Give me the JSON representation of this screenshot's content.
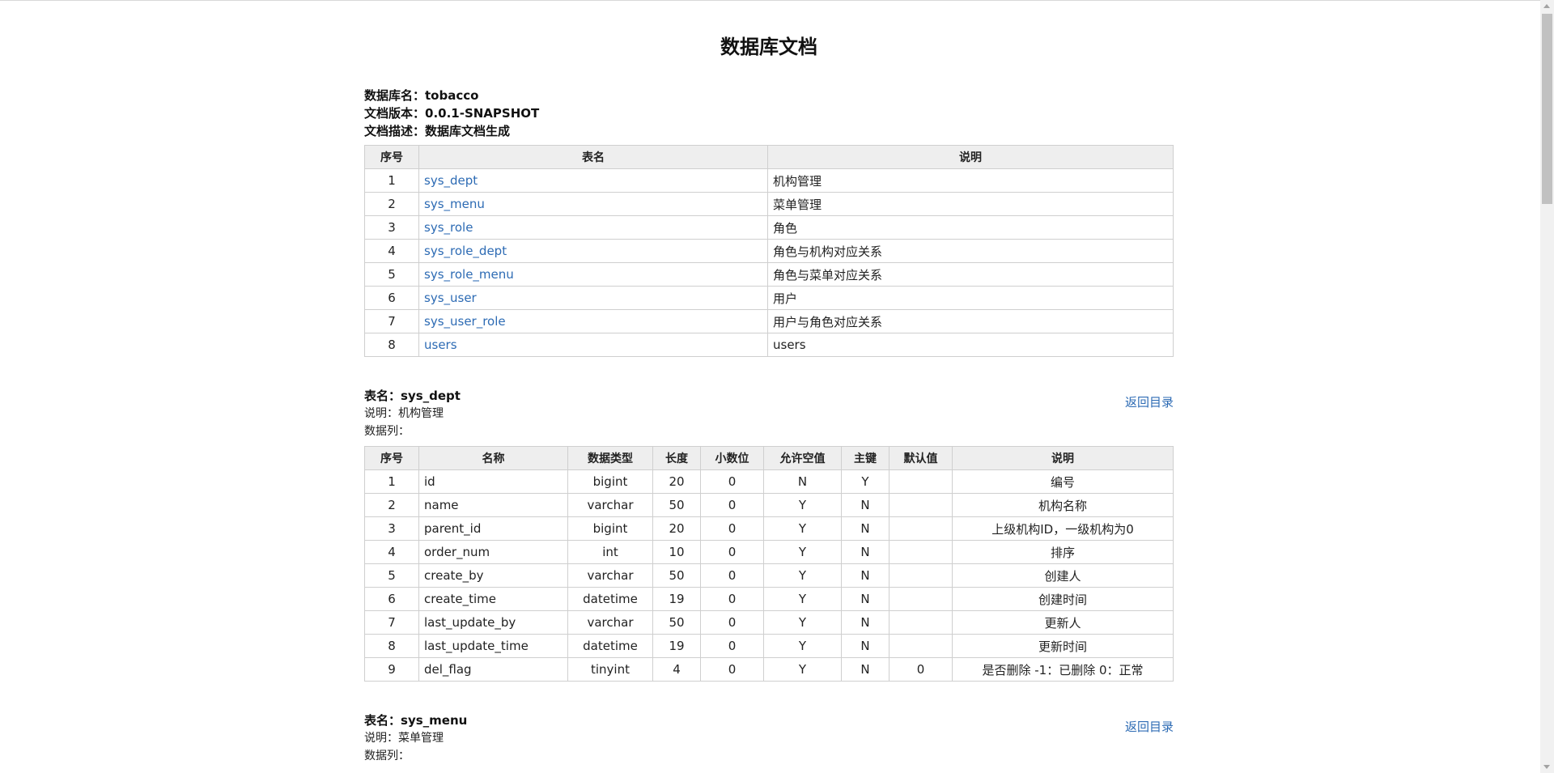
{
  "doc": {
    "title": "数据库文档",
    "db_label": "数据库名：",
    "db_name": "tobacco",
    "version_label": "文档版本：",
    "version": "0.0.1-SNAPSHOT",
    "desc_label": "文档描述：",
    "desc": "数据库文档生成"
  },
  "toc": {
    "headers": [
      "序号",
      "表名",
      "说明"
    ],
    "rows": [
      {
        "no": "1",
        "name": "sys_dept",
        "desc": "机构管理"
      },
      {
        "no": "2",
        "name": "sys_menu",
        "desc": "菜单管理"
      },
      {
        "no": "3",
        "name": "sys_role",
        "desc": "角色"
      },
      {
        "no": "4",
        "name": "sys_role_dept",
        "desc": "角色与机构对应关系"
      },
      {
        "no": "5",
        "name": "sys_role_menu",
        "desc": "角色与菜单对应关系"
      },
      {
        "no": "6",
        "name": "sys_user",
        "desc": "用户"
      },
      {
        "no": "7",
        "name": "sys_user_role",
        "desc": "用户与角色对应关系"
      },
      {
        "no": "8",
        "name": "users",
        "desc": "users"
      }
    ]
  },
  "back_label": "返回目录",
  "tables": [
    {
      "name_label": "表名：",
      "name": "sys_dept",
      "desc_line": "说明：机构管理",
      "cols_label": "数据列：",
      "headers": [
        "序号",
        "名称",
        "数据类型",
        "长度",
        "小数位",
        "允许空值",
        "主键",
        "默认值",
        "说明"
      ],
      "rows": [
        [
          "1",
          "id",
          "bigint",
          "20",
          "0",
          "N",
          "Y",
          "",
          "编号"
        ],
        [
          "2",
          "name",
          "varchar",
          "50",
          "0",
          "Y",
          "N",
          "",
          "机构名称"
        ],
        [
          "3",
          "parent_id",
          "bigint",
          "20",
          "0",
          "Y",
          "N",
          "",
          "上级机构ID，一级机构为0"
        ],
        [
          "4",
          "order_num",
          "int",
          "10",
          "0",
          "Y",
          "N",
          "",
          "排序"
        ],
        [
          "5",
          "create_by",
          "varchar",
          "50",
          "0",
          "Y",
          "N",
          "",
          "创建人"
        ],
        [
          "6",
          "create_time",
          "datetime",
          "19",
          "0",
          "Y",
          "N",
          "",
          "创建时间"
        ],
        [
          "7",
          "last_update_by",
          "varchar",
          "50",
          "0",
          "Y",
          "N",
          "",
          "更新人"
        ],
        [
          "8",
          "last_update_time",
          "datetime",
          "19",
          "0",
          "Y",
          "N",
          "",
          "更新时间"
        ],
        [
          "9",
          "del_flag",
          "tinyint",
          "4",
          "0",
          "Y",
          "N",
          "0",
          "是否删除 -1：已删除 0：正常"
        ]
      ]
    },
    {
      "name_label": "表名：",
      "name": "sys_menu",
      "desc_line": "说明：菜单管理",
      "cols_label": "数据列："
    }
  ]
}
